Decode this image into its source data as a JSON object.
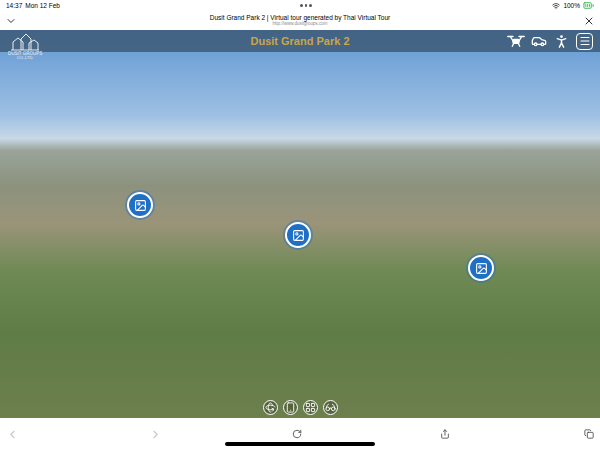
{
  "status_bar": {
    "time": "14:37",
    "date": "Mon 12 Feb",
    "battery": "100%"
  },
  "browser": {
    "title": "Dusit Grand Park 2 | Virtual tour generated by Thai Virtual Tour",
    "url": "http://www.dusitgroups.com"
  },
  "tour": {
    "title": "Dusit Grand Park 2",
    "logo": {
      "name": "DUSIT GROUPS",
      "sub": "CO.,LTD."
    },
    "modes": [
      {
        "kind": "drone"
      },
      {
        "kind": "car"
      },
      {
        "kind": "walk"
      },
      {
        "kind": "menu"
      }
    ],
    "hotspots": [
      {
        "kind": "photo"
      },
      {
        "kind": "photo"
      },
      {
        "kind": "photo"
      }
    ],
    "controls": [
      {
        "kind": "autorotate"
      },
      {
        "kind": "gyro"
      },
      {
        "kind": "gallery"
      },
      {
        "kind": "vr"
      }
    ]
  },
  "toolbar": {
    "back": {
      "disabled": true
    },
    "forward": {
      "disabled": true
    }
  }
}
